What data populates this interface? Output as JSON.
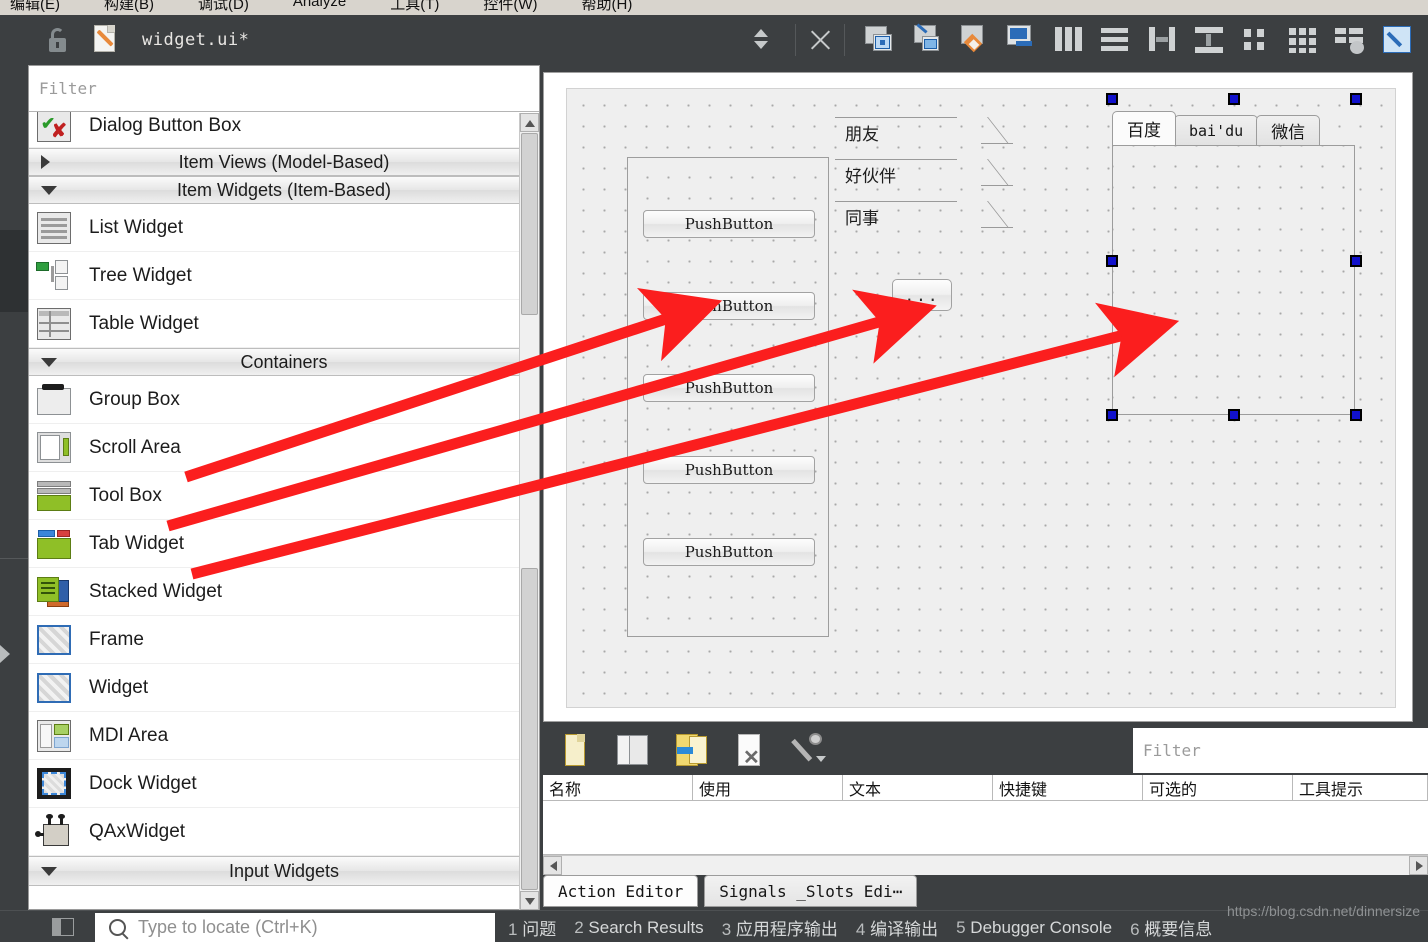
{
  "menu": {
    "items": [
      "编辑(E)",
      "构建(B)",
      "调试(D)",
      "Analyze",
      "工具(T)",
      "控件(W)",
      "帮助(H)"
    ]
  },
  "designer_toolbar": {
    "file_name": "widget.ui*",
    "lock_icon": "lock-open-icon",
    "file_icon": "edit-file-icon",
    "split_icon": "split-arrows-icon",
    "close_icon": "close-icon",
    "tools": [
      "edit-widgets-icon",
      "edit-signals-slots-icon",
      "edit-buddies-icon",
      "edit-tab-order-icon",
      "layout-horizontally-icon",
      "layout-vertically-icon",
      "layout-splitter-horizontal-icon",
      "layout-splitter-vertical-icon",
      "layout-form-icon",
      "layout-grid-icon",
      "break-layout-icon",
      "adjust-size-icon"
    ]
  },
  "widget_box": {
    "filter_placeholder": "Filter",
    "rows": [
      {
        "kind": "item",
        "label": "Dialog Button Box",
        "icon": "dialog-button-box-icon"
      },
      {
        "kind": "category",
        "label": "Item Views (Model-Based)",
        "expanded": false
      },
      {
        "kind": "category",
        "label": "Item Widgets (Item-Based)",
        "expanded": true
      },
      {
        "kind": "item",
        "label": "List Widget",
        "icon": "list-widget-icon"
      },
      {
        "kind": "item",
        "label": "Tree Widget",
        "icon": "tree-widget-icon"
      },
      {
        "kind": "item",
        "label": "Table Widget",
        "icon": "table-widget-icon"
      },
      {
        "kind": "category",
        "label": "Containers",
        "expanded": true
      },
      {
        "kind": "item",
        "label": "Group Box",
        "icon": "group-box-icon"
      },
      {
        "kind": "item",
        "label": "Scroll Area",
        "icon": "scroll-area-icon"
      },
      {
        "kind": "item",
        "label": "Tool Box",
        "icon": "tool-box-icon"
      },
      {
        "kind": "item",
        "label": "Tab Widget",
        "icon": "tab-widget-icon"
      },
      {
        "kind": "item",
        "label": "Stacked Widget",
        "icon": "stacked-widget-icon"
      },
      {
        "kind": "item",
        "label": "Frame",
        "icon": "frame-icon"
      },
      {
        "kind": "item",
        "label": "Widget",
        "icon": "widget-icon"
      },
      {
        "kind": "item",
        "label": "MDI Area",
        "icon": "mdi-area-icon"
      },
      {
        "kind": "item",
        "label": "Dock Widget",
        "icon": "dock-widget-icon"
      },
      {
        "kind": "item",
        "label": "QAxWidget",
        "icon": "qax-widget-icon"
      },
      {
        "kind": "category",
        "label": "Input Widgets",
        "expanded": true
      }
    ]
  },
  "form": {
    "scroll_area": {
      "buttons": [
        "PushButton",
        "PushButton",
        "PushButton",
        "PushButton",
        "PushButton"
      ]
    },
    "tool_box": {
      "pages": [
        "朋友",
        "好伙伴",
        "同事"
      ]
    },
    "dots_button": "...",
    "tab_widget": {
      "tabs": [
        {
          "label": "百度",
          "active": true
        },
        {
          "label": "bai'du",
          "active": false,
          "latin": true
        },
        {
          "label": "微信",
          "active": false
        }
      ]
    }
  },
  "annotations": {
    "arrow_color": "#fb1e1e",
    "arrows": [
      {
        "from": "Scroll Area",
        "to": "scroll-area-on-form"
      },
      {
        "from": "Tool Box",
        "to": "tool-box-on-form"
      },
      {
        "from": "Tab Widget",
        "to": "tab-widget-on-form"
      }
    ]
  },
  "action_editor": {
    "toolbar_icons": [
      "new-action-icon",
      "copy-action-icon",
      "paste-action-icon",
      "delete-action-icon",
      "configure-icon"
    ],
    "filter_placeholder": "Filter",
    "columns": [
      "名称",
      "使用",
      "文本",
      "快捷键",
      "可选的",
      "工具提示"
    ],
    "rows": []
  },
  "bottom_tabs": [
    {
      "label": "Action Editor",
      "active": true
    },
    {
      "label": "Signals _Slots Edi⋯",
      "active": false
    }
  ],
  "status_bar": {
    "locate_placeholder": "Type to locate (Ctrl+K)",
    "search_icon": "search-icon",
    "panel_icon": "toggle-sidebar-icon",
    "items": [
      {
        "num": "1",
        "label": "问题"
      },
      {
        "num": "2",
        "label": "Search Results"
      },
      {
        "num": "3",
        "label": "应用程序输出"
      },
      {
        "num": "4",
        "label": "编译输出"
      },
      {
        "num": "5",
        "label": "Debugger Console"
      },
      {
        "num": "6",
        "label": "概要信息"
      }
    ],
    "watermark": "https://blog.csdn.net/dinnersize"
  }
}
